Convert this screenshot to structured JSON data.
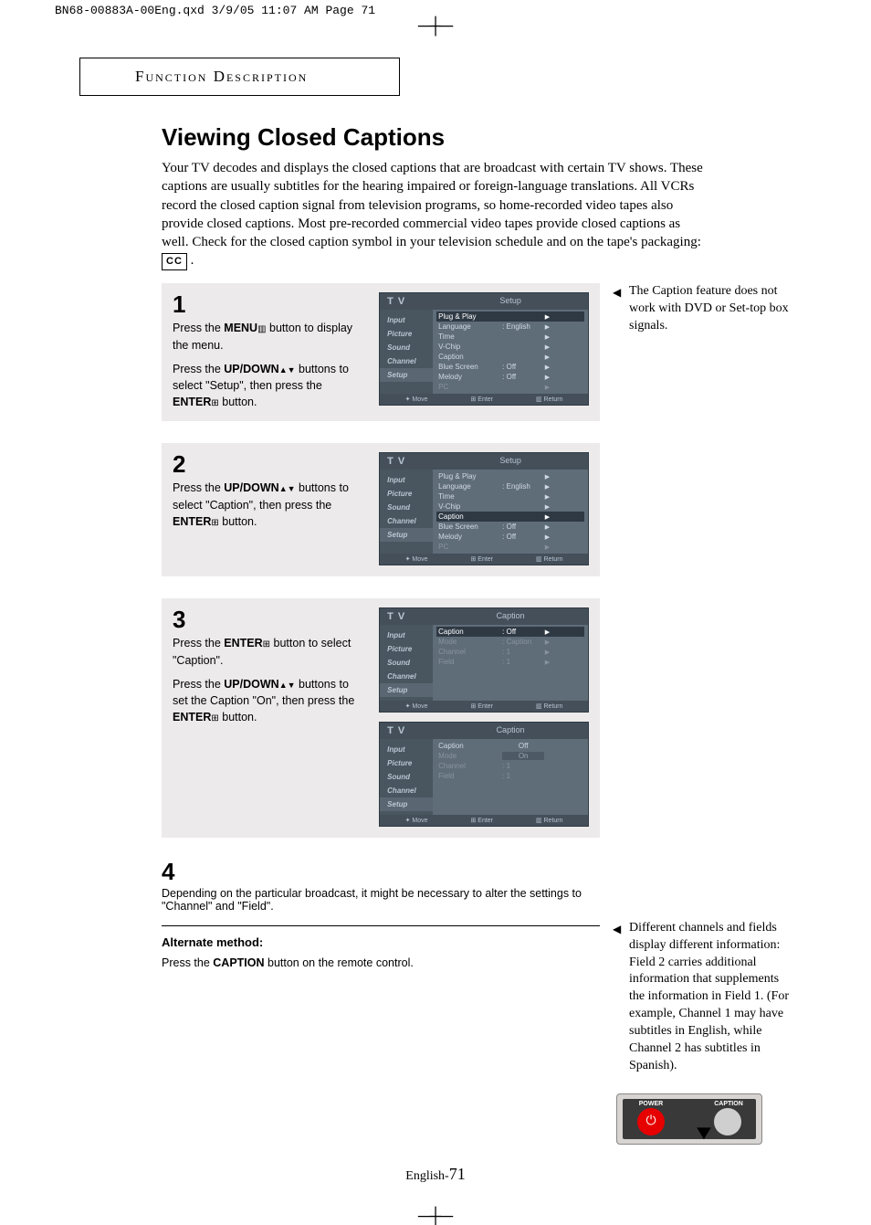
{
  "header_line": "BN68-00883A-00Eng.qxd  3/9/05 11:07 AM  Page 71",
  "section_title": "Function Description",
  "title": "Viewing Closed Captions",
  "intro": "Your TV decodes and displays the closed captions that are broadcast with certain TV shows. These captions are usually subtitles for the hearing impaired or foreign-language translations. All VCRs record the closed caption signal from television programs, so home-recorded video tapes also provide closed captions. Most pre-recorded commercial video tapes provide closed captions as well. Check for the closed caption symbol in your television schedule and on the tape's packaging:",
  "cc_symbol": "CC",
  "right_note_top": "The Caption feature does not work with DVD or Set-top box signals.",
  "right_note_bottom": "Different channels and fields display different information: Field 2 carries additional information that supplements the information in Field 1. (For example, Channel 1 may have subtitles in English, while Channel 2 has subtitles in Spanish).",
  "steps": {
    "s1": {
      "num": "1",
      "p1a": "Press the ",
      "p1b": "MENU",
      "p1c": " button to display the menu.",
      "p2a": "Press the ",
      "p2b": "UP/DOWN",
      "p2c": " buttons to select \"Setup\", then press the ",
      "p2d": "ENTER",
      "p2e": " button."
    },
    "s2": {
      "num": "2",
      "p1a": "Press the ",
      "p1b": "UP/DOWN",
      "p1c": " buttons to select \"Caption\", then press the ",
      "p1d": "ENTER",
      "p1e": " button."
    },
    "s3": {
      "num": "3",
      "p1a": "Press the ",
      "p1b": "ENTER",
      "p1c": " button to select \"Caption\".",
      "p2a": "Press the ",
      "p2b": "UP/DOWN",
      "p2c": " buttons to set the Caption \"On\", then press the ",
      "p2d": "ENTER",
      "p2e": " button."
    },
    "s4": {
      "num": "4",
      "text": "Depending on the particular broadcast, it might be necessary to alter the settings to \"Channel\" and \"Field\"."
    }
  },
  "alt": {
    "title": "Alternate method:",
    "text_a": "Press the ",
    "text_b": "CAPTION",
    "text_c": " button on the remote control."
  },
  "osd": {
    "tv": "T V",
    "tab_setup": "Setup",
    "tab_caption": "Caption",
    "side": [
      "Input",
      "Picture",
      "Sound",
      "Channel",
      "Setup"
    ],
    "rows_setup": [
      {
        "label": "Plug & Play",
        "val": "",
        "sel": false
      },
      {
        "label": "Language",
        "val": ": English",
        "sel": false
      },
      {
        "label": "Time",
        "val": "",
        "sel": false
      },
      {
        "label": "V-Chip",
        "val": "",
        "sel": false
      },
      {
        "label": "Caption",
        "val": "",
        "sel": false
      },
      {
        "label": "Blue Screen",
        "val": ": Off",
        "sel": false
      },
      {
        "label": "Melody",
        "val": ": Off",
        "sel": false
      },
      {
        "label": "PC",
        "val": "",
        "sel": false,
        "dim": true
      }
    ],
    "rows_caption_a": [
      {
        "label": "Caption",
        "val": ": Off",
        "sel": true
      },
      {
        "label": "Mode",
        "val": ": Caption",
        "sel": false,
        "dim": true
      },
      {
        "label": "Channel",
        "val": ": 1",
        "sel": false,
        "dim": true
      },
      {
        "label": "Field",
        "val": ": 1",
        "sel": false,
        "dim": true
      }
    ],
    "rows_caption_b": [
      {
        "label": "Caption",
        "val": "Off",
        "sel": false
      },
      {
        "label": "Mode",
        "val": "On",
        "sel": true,
        "dim": false
      },
      {
        "label": "Channel",
        "val": ": 1",
        "sel": false,
        "dim": true
      },
      {
        "label": "Field",
        "val": ": 1",
        "sel": false,
        "dim": true
      }
    ],
    "footer": {
      "move": "✦ Move",
      "enter": "⊞ Enter",
      "ret": "▥ Return"
    }
  },
  "remote": {
    "power": "POWER",
    "caption": "CAPTION"
  },
  "footer": {
    "prefix": "English-",
    "page": "71"
  }
}
